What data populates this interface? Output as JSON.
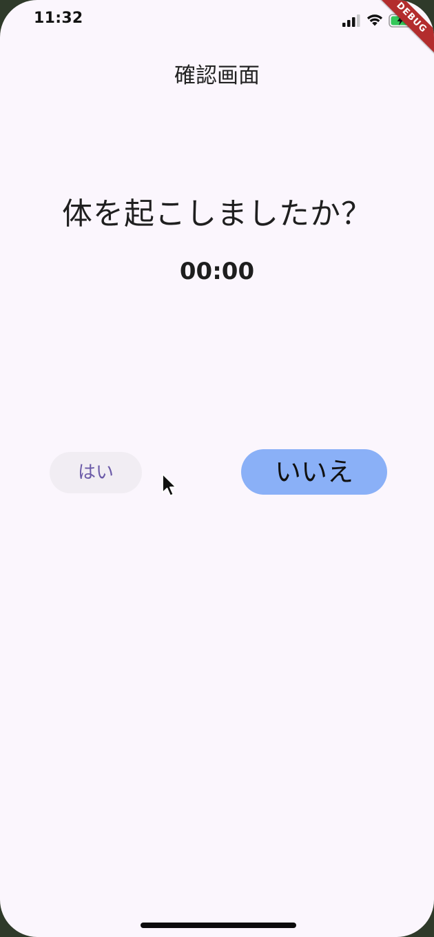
{
  "status_bar": {
    "time": "11:32",
    "signal_icon": "cellular-signal-icon",
    "wifi_icon": "wifi-icon",
    "battery_icon": "battery-charging-icon",
    "battery_color": "#34c759"
  },
  "debug_banner": {
    "label": "DEBUG",
    "color": "#b32d2d"
  },
  "app_bar": {
    "title": "確認画面"
  },
  "main": {
    "question": "体を起こしましたか？",
    "timer": "00:00"
  },
  "buttons": {
    "yes_label": "はい",
    "no_label": "いいえ",
    "no_button_color": "#8ab0f7"
  },
  "cursor": {
    "icon": "mouse-pointer-icon"
  }
}
